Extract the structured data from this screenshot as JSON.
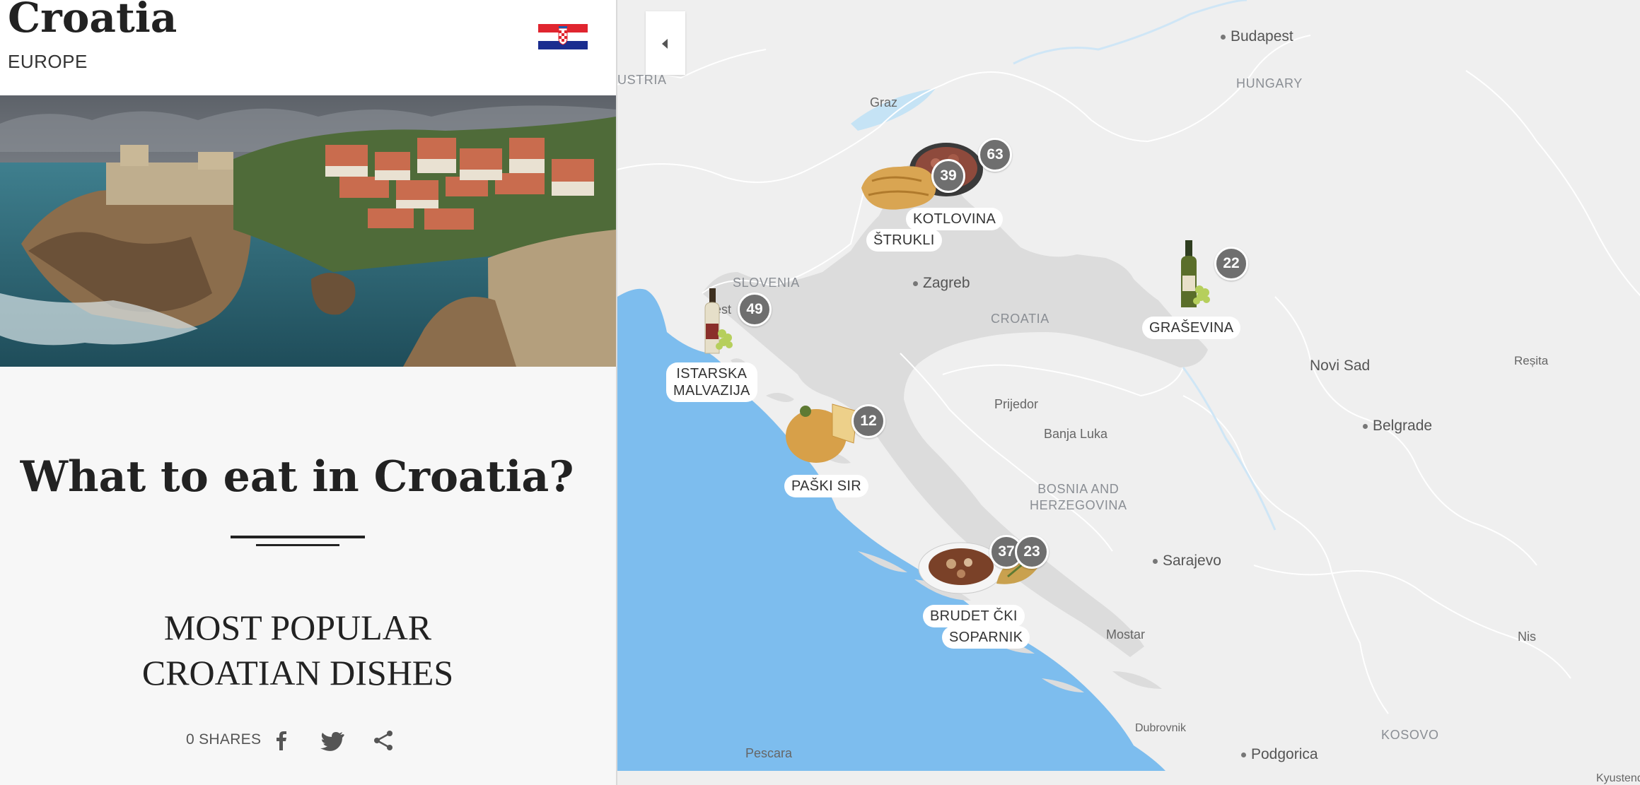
{
  "header": {
    "country": "Croatia",
    "continent": "EUROPE"
  },
  "colors": {
    "sea": "#7dbdee",
    "land": "#efefef",
    "croatia_land": "#dcdcdc",
    "badge": "#6f6f6f",
    "flag_red": "#e0252f",
    "flag_blue": "#1a2d8f"
  },
  "article": {
    "headline": "What to eat in Croatia?",
    "subheading_line1": "MOST POPULAR",
    "subheading_line2": "CROATIAN DISHES",
    "shares": "0 SHARES"
  },
  "share_icons": [
    "facebook-icon",
    "twitter-icon",
    "share-icon"
  ],
  "map": {
    "cities": {
      "budapest": "Budapest",
      "zagreb": "Zagreb",
      "novi_sad": "Novi Sad",
      "belgrade": "Belgrade",
      "sarajevo": "Sarajevo",
      "podgorica": "Podgorica"
    },
    "countries": {
      "austria": "USTRIA",
      "hungary": "HUNGARY",
      "slovenia": "SLOVENIA",
      "croatia": "CROATIA",
      "bosnia_line1": "BOSNIA AND",
      "bosnia_line2": "HERZEGOVINA",
      "kosovo": "KOSOVO"
    },
    "towns": {
      "graz": "Graz",
      "trieste": "est",
      "prijedor": "Prijedor",
      "banja_luka": "Banja Luka",
      "mostar": "Mostar",
      "dubrovnik": "Dubrovnik",
      "pescara": "Pescara",
      "resita": "Reșita",
      "nis": "Nis",
      "kyustendil": "Kyustendi"
    },
    "dishes": [
      {
        "label": "KOTLOVINA",
        "count": "63"
      },
      {
        "label": "ŠTRUKLI",
        "count": "39"
      },
      {
        "label": "GRAŠEVINA",
        "count": "22"
      },
      {
        "label_line1": "ISTARSKA",
        "label_line2": "MALVAZIJA",
        "count": "49"
      },
      {
        "label": "PAŠKI SIR",
        "count": "12"
      },
      {
        "label": "BRUDET ČKI",
        "count": "37"
      },
      {
        "label": "SOPARNIK",
        "count": "23"
      }
    ]
  }
}
